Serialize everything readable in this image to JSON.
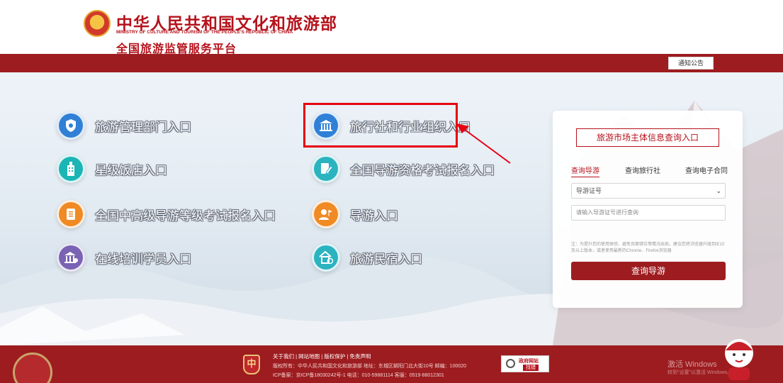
{
  "header": {
    "ministry_cn": "中华人民共和国文化和旅游部",
    "ministry_en": "MINISTRY OF CULTURE AND TOURISM OF THE PEOPLE'S REPUBLIC OF CHINA",
    "platform_title": "全国旅游监管服务平台"
  },
  "navbar": {
    "notice_label": "通知公告"
  },
  "entries": [
    {
      "label": "旅游管理部门入口",
      "icon": "shield-icon",
      "color": "#2f80d6"
    },
    {
      "label": "旅行社和行业组织入口",
      "icon": "building-icon",
      "color": "#2f80d6"
    },
    {
      "label": "星级饭店入口",
      "icon": "hotel-icon",
      "color": "#1bb5b5"
    },
    {
      "label": "全国导游资格考试报名入口",
      "icon": "edit-doc-icon",
      "color": "#2bb3c0"
    },
    {
      "label": "全国中高级导游等级考试报名入口",
      "icon": "document-icon",
      "color": "#f08a24"
    },
    {
      "label": "导游入口",
      "icon": "tour-guide-icon",
      "color": "#f08a24"
    },
    {
      "label": "在线培训学员入口",
      "icon": "training-icon",
      "color": "#7a62b4"
    },
    {
      "label": "旅游民宿入口",
      "icon": "homestay-icon",
      "color": "#2bb3c0"
    }
  ],
  "query_panel": {
    "title": "旅游市场主体信息查询入口",
    "tabs": [
      {
        "label": "查询导游",
        "active": true
      },
      {
        "label": "查询旅行社",
        "active": false
      },
      {
        "label": "查询电子合同",
        "active": false
      }
    ],
    "select_value": "导游证号",
    "input_placeholder": "请输入导游证号进行查询",
    "note": "注：为提升您的使用体验、避免页面错位等情况出现，建议您将浏览器升级到IE10及以上版本，或者使用最新的Chrome、Firefox浏览器",
    "button_label": "查询导游"
  },
  "footer": {
    "badge_char": "中",
    "links": "关于我们 | 网站地图 | 版权保护 | 免责声明",
    "copyright": "版权所有：中华人民共和国文化和旅游部 地址：东城区朝阳门北大街10号 邮编：100020",
    "icp": "ICP备案：京ICP备18030242号-1 电话：010-59881114 客服：0519-88012301",
    "gov_site": "政府网站",
    "find_error": "找错"
  },
  "watermark": {
    "line1": "激活 Windows",
    "line2": "转到\"设置\"以激活 Windows。"
  },
  "colors": {
    "brand_red": "#9d1c1f",
    "title_red": "#b5121b",
    "highlight_red": "#e60012"
  }
}
